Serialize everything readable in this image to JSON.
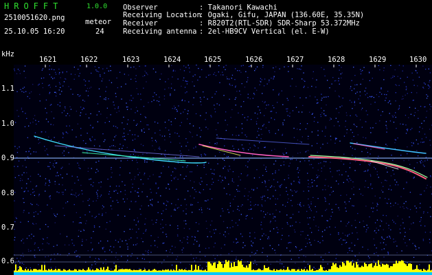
{
  "header": {
    "app_title": "HROFFT",
    "app_version": "1.0.0",
    "file_name": "2510051620.png",
    "meteor_label": "meteor",
    "date_time": "25.10.05 16:20",
    "meteor_count": "24",
    "info_rows": [
      {
        "label": "Observer",
        "value": ": Takanori Kawachi"
      },
      {
        "label": "Receiving Location",
        "value": ": Ogaki, Gifu, JAPAN (136.60E, 35.35N)"
      },
      {
        "label": "Receiver",
        "value": ": R820T2(RTL-SDR) SDR-Sharp 53.372MHz"
      },
      {
        "label": "Receiving antenna",
        "value": ": 2el-HB9CV Vertical (el. E-W)"
      }
    ]
  },
  "axes": {
    "y_unit": "kHz",
    "x_ticks": [
      "1621",
      "1622",
      "1623",
      "1624",
      "1625",
      "1626",
      "1627",
      "1628",
      "1629",
      "1630"
    ],
    "y_ticks": [
      "1.1",
      "1.0",
      "0.9",
      "0.8",
      "0.7",
      "0.6"
    ]
  },
  "colors": {
    "header_green": "#2fe02f",
    "background": "#000010",
    "noise": "#2030c0",
    "carrier": "#8ab4ff",
    "noise_floor": "#ffff00",
    "noise_base": "#00c8ff"
  }
}
